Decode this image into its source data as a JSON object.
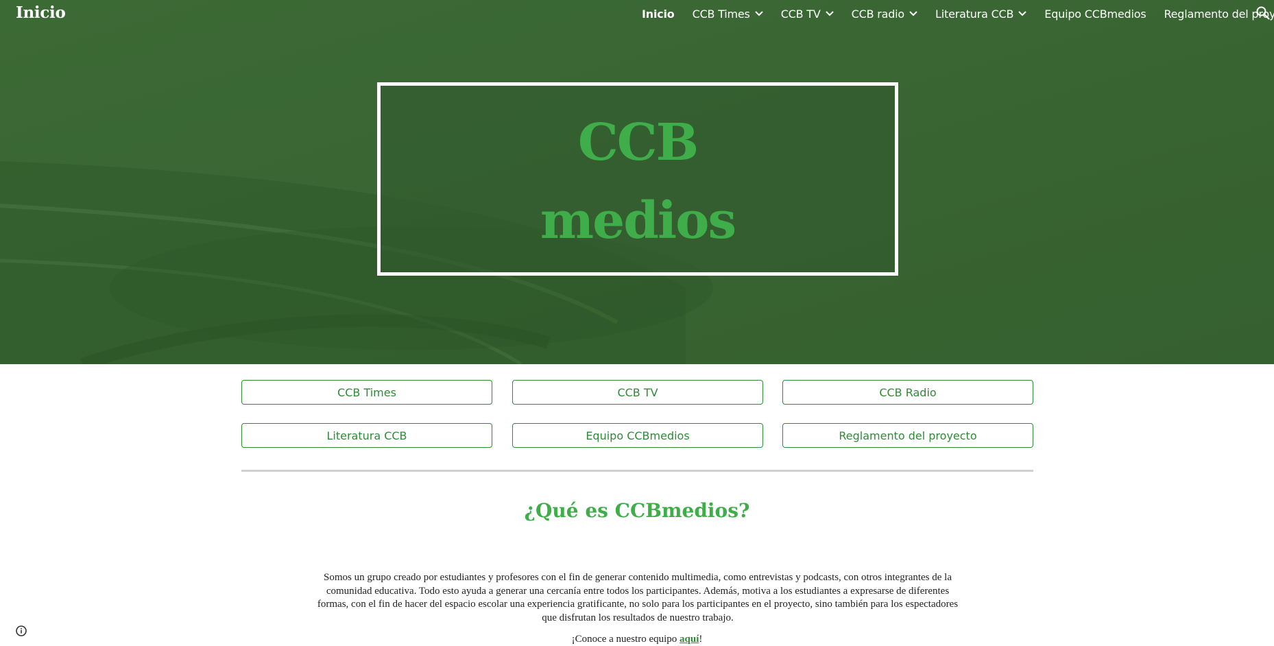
{
  "header": {
    "site_title": "Inicio",
    "nav": [
      {
        "label": "Inicio",
        "active": true,
        "has_dropdown": false
      },
      {
        "label": "CCB Times",
        "active": false,
        "has_dropdown": true
      },
      {
        "label": "CCB TV",
        "active": false,
        "has_dropdown": true
      },
      {
        "label": "CCB radio",
        "active": false,
        "has_dropdown": true
      },
      {
        "label": "Literatura CCB",
        "active": false,
        "has_dropdown": true
      },
      {
        "label": "Equipo CCBmedios",
        "active": false,
        "has_dropdown": false
      },
      {
        "label": "Reglamento del proyecto",
        "active": false,
        "has_dropdown": false
      }
    ],
    "search_icon": "search-icon"
  },
  "hero": {
    "line1": "CCB",
    "line2": "medios"
  },
  "buttons": [
    "CCB Times",
    "CCB TV",
    "CCB Radio",
    "Literatura CCB",
    "Equipo CCBmedios",
    "Reglamento del proyecto"
  ],
  "section": {
    "heading": "¿Qué es CCBmedios?",
    "body": "Somos un grupo creado por estudiantes y profesores con el fin de generar contenido multimedia, como entrevistas y podcasts, con otros integrantes de la comunidad educativa. Todo esto ayuda a generar una cercanía entre todos los participantes. Además, motiva a los estudiantes a expresarse de diferentes formas, con el fin de hacer del espacio escolar una experiencia gratificante, no solo para los participantes en el proyecto, sino también para los espectadores que disfrutan los resultados de nuestro trabajo.",
    "cta_prefix": "¡Conoce a nuestro equipo ",
    "cta_link": "aquí",
    "cta_suffix": "!"
  },
  "colors": {
    "hero_green": "#3a6634",
    "accent_green": "#3fae4a",
    "button_green": "#2e8b36"
  },
  "footer": {
    "info_icon": "info-icon"
  }
}
